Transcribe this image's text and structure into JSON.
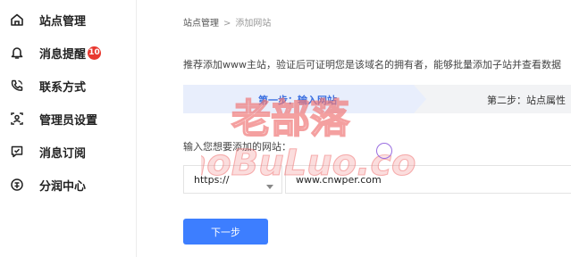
{
  "sidebar": {
    "items": [
      {
        "label": "站点管理",
        "icon": "home-icon"
      },
      {
        "label": "消息提醒",
        "icon": "bell-icon",
        "badge": "10"
      },
      {
        "label": "联系方式",
        "icon": "phone-icon"
      },
      {
        "label": "管理员设置",
        "icon": "admin-card-icon"
      },
      {
        "label": "消息订阅",
        "icon": "subscribe-icon"
      },
      {
        "label": "分润中心",
        "icon": "coin-icon"
      }
    ]
  },
  "breadcrumb": {
    "parent": "站点管理",
    "separator": ">",
    "current": "添加网站"
  },
  "description": "推荐添加www主站，验证后可证明您是该域名的拥有者，能够批量添加子站并查看数据",
  "steps": [
    {
      "label": "第一步：输入网站",
      "active": true
    },
    {
      "label": "第二步：站点属性",
      "active": false
    }
  ],
  "form": {
    "label": "输入您想要添加的网站：",
    "protocol": "https://",
    "domain": "www.cnwper.com",
    "next_button": "下一步"
  },
  "watermark": {
    "cn": "老部落",
    "en": "LaoBuLuo.com"
  },
  "colors": {
    "accent": "#3d7eff",
    "badge": "#e8382f",
    "active_step_bg": "#e8eefc",
    "active_step_text": "#3a6fe0",
    "watermark": "#f07878"
  }
}
